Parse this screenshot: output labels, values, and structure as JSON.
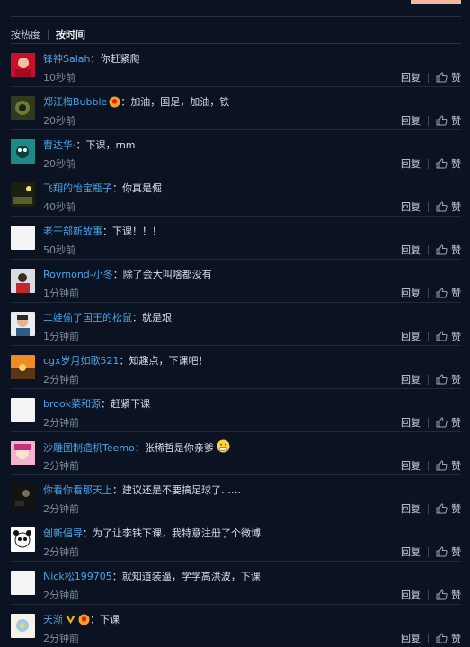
{
  "sort": {
    "hot": "按热度",
    "time": "按时间"
  },
  "actions": {
    "reply": "回复",
    "like": "赞"
  },
  "colors": {
    "username": "#4aa3e6",
    "background": "#0b1322",
    "time": "#7f8b99"
  },
  "comments": [
    {
      "user": "锋神Salah",
      "text": "你赶紧爬",
      "time": "10秒前",
      "avatar": "red-avatar"
    },
    {
      "user": "郑江梅Bubble",
      "text": "加油，国足，加油，铁",
      "time": "20秒前",
      "avatar": "olive-avatar",
      "badge": "vip-badge"
    },
    {
      "user": "曹达华·",
      "text": "下课，rnm",
      "time": "20秒前",
      "avatar": "teal-cartoon-avatar"
    },
    {
      "user": "飞翔的怡宝瓶子",
      "text": "你真是倔",
      "time": "40秒前",
      "avatar": "dark-photo-avatar"
    },
    {
      "user": "老干部新故事",
      "text": "下课！！！",
      "time": "50秒前",
      "avatar": "blank-avatar"
    },
    {
      "user": "Roymond-小冬",
      "text": "除了会大叫啥都没有",
      "time": "1分钟前",
      "avatar": "red-person-avatar"
    },
    {
      "user": "二娃偷了国王的松鼠",
      "text": "就是艰",
      "time": "1分钟前",
      "avatar": "boy-avatar"
    },
    {
      "user": "cgx岁月如歌521",
      "text": "知趣点，下课吧！",
      "time": "2分钟前",
      "avatar": "sunset-avatar"
    },
    {
      "user": "brook菜和源",
      "text": "赶紧下课",
      "time": "2分钟前",
      "avatar": "blank-avatar"
    },
    {
      "user": "沙雕图制造机Teemo",
      "text": "张稀哲是你亲爹",
      "time": "2分钟前",
      "avatar": "pink-anime-avatar",
      "emoji": "grin-emoji"
    },
    {
      "user": "你看你看那天上",
      "text": "建议还是不要搞足球了……",
      "time": "2分钟前",
      "avatar": "dark-avatar"
    },
    {
      "user": "创新倡导",
      "text": "为了让李铁下课，我特意注册了个微博",
      "time": "2分钟前",
      "avatar": "panda-avatar"
    },
    {
      "user": "Nick松199705",
      "text": "就知道装逼，学学高洪波，下课",
      "time": "2分钟前",
      "avatar": "blank-avatar"
    },
    {
      "user": "天渐",
      "text": "下课",
      "time": "2分钟前",
      "avatar": "flower-avatar",
      "badge": "v-badge",
      "badge2": "vip-badge"
    }
  ]
}
